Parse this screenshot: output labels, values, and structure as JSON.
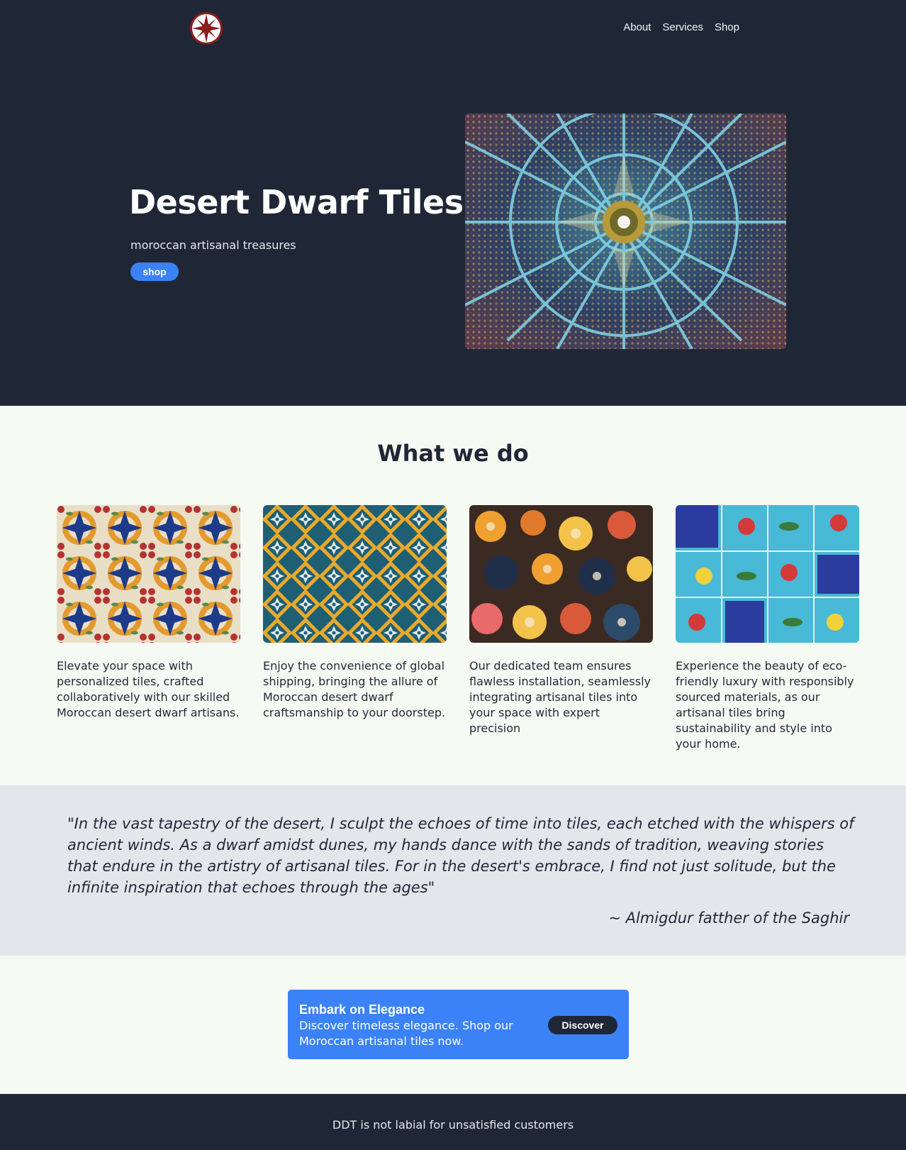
{
  "header": {
    "logo_alt": "Desert Dwarf Tiles logo",
    "nav": [
      {
        "label": "About"
      },
      {
        "label": "Services"
      },
      {
        "label": "Shop"
      }
    ]
  },
  "hero": {
    "title": "Desert Dwarf Tiles",
    "subtitle": "moroccan artisanal treasures",
    "button_label": "shop",
    "image_alt": "Ornate mosaic dome ceiling"
  },
  "services": {
    "title": "What we do",
    "cards": [
      {
        "text": "Elevate your space with personalized tiles, crafted collaboratively with our skilled Moroccan desert dwarf artisans."
      },
      {
        "text": "Enjoy the convenience of global shipping, bringing the allure of Moroccan desert dwarf craftsmanship to your doorstep."
      },
      {
        "text": "Our dedicated team ensures flawless installation, seamlessly integrating artisanal tiles into your space with expert precision"
      },
      {
        "text": "Experience the beauty of eco-friendly luxury with responsibly sourced materials, as our artisanal tiles bring sustainability and style into your home."
      }
    ]
  },
  "quote": {
    "text": "\"In the vast tapestry of the desert, I sculpt the echoes of time into tiles, each etched with the whispers of ancient winds. As a dwarf amidst dunes, my hands dance with the sands of tradition, weaving stories that endure in the artistry of artisanal tiles. For in the desert's embrace, I find not just solitude, but the infinite inspiration that echoes through the ages\"",
    "author": "~ Almigdur fatther of the Saghir"
  },
  "cta": {
    "title": "Embark on Elegance",
    "body": "Discover timeless elegance. Shop our Moroccan artisanal tiles now.",
    "button_label": "Discover"
  },
  "footer": {
    "text": "DDT is not labial for unsatisfied customers"
  },
  "colors": {
    "dark": "#1f2737",
    "accent": "#3b82f6",
    "page_bg": "#f5faf3",
    "quote_bg": "#e3e6eb"
  }
}
